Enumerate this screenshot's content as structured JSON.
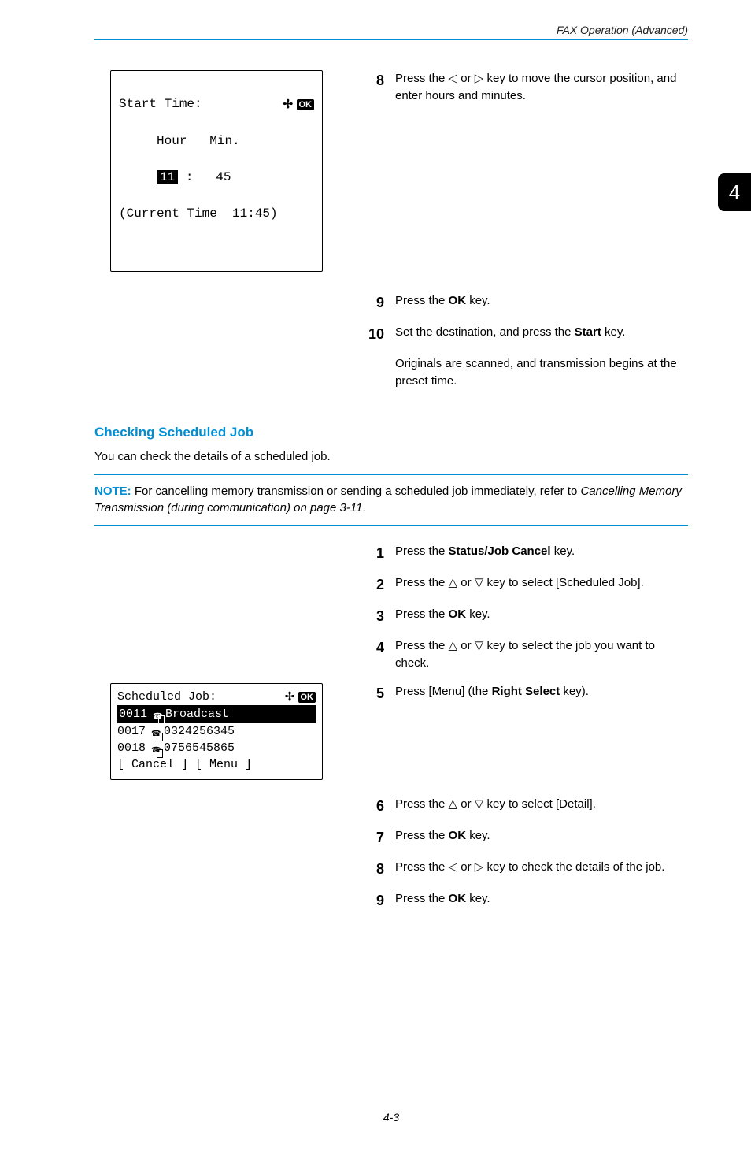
{
  "header": {
    "title": "FAX Operation (Advanced)"
  },
  "right_tab": "4",
  "lcd1": {
    "title": "Start Time:",
    "hour_label": "Hour",
    "min_label": "Min.",
    "hour_value": "11",
    "min_value": "45",
    "separator": ":",
    "current_line": "(Current Time  11:45)",
    "ok": "OK"
  },
  "step8": {
    "num": "8",
    "text_a": "Press the ",
    "text_b": " or ",
    "text_c": " key to move the cursor position, and enter hours and minutes."
  },
  "step9": {
    "num": "9",
    "text_a": "Press the ",
    "bold": "OK",
    "text_b": " key."
  },
  "step10": {
    "num": "10",
    "text_a": "Set the destination, and press the ",
    "bold": "Start",
    "text_b": " key.",
    "note": "Originals are scanned, and transmission begins at the preset time."
  },
  "section": {
    "heading": "Checking Scheduled Job",
    "para": "You can check the details of a scheduled job."
  },
  "note": {
    "label": "NOTE:",
    "text_a": " For cancelling memory transmission or sending a scheduled job immediately, refer to ",
    "italic": "Cancelling Memory Transmission (during communication) on page 3-11",
    "text_b": "."
  },
  "list2": {
    "s1": {
      "num": "1",
      "a": "Press the ",
      "bold": "Status/Job Cancel",
      "b": " key."
    },
    "s2": {
      "num": "2",
      "a": "Press the ",
      "b": " or ",
      "c": " key to select [Scheduled Job]."
    },
    "s3": {
      "num": "3",
      "a": "Press the ",
      "bold": "OK",
      "b": " key."
    },
    "s4": {
      "num": "4",
      "a": "Press the ",
      "b": " or ",
      "c": " key to select the job you want to check."
    },
    "s5": {
      "num": "5",
      "a": "Press [Menu] (the ",
      "bold": "Right Select",
      "b": " key)."
    },
    "s6": {
      "num": "6",
      "a": "Press the ",
      "b": " or ",
      "c": " key to select [Detail]."
    },
    "s7": {
      "num": "7",
      "a": "Press the ",
      "bold": "OK",
      "b": " key."
    },
    "s8": {
      "num": "8",
      "a": "Press the ",
      "b": " or ",
      "c": " key to check the details of the job."
    },
    "s9": {
      "num": "9",
      "a": "Press the ",
      "bold": "OK",
      "b": " key."
    }
  },
  "lcd2": {
    "title": "Scheduled Job:",
    "ok": "OK",
    "row1_id": "0011",
    "row1_text": "Broadcast",
    "row2_id": "0017",
    "row2_text": "0324256345",
    "row3_id": "0018",
    "row3_text": "0756545865",
    "footer": "[ Cancel ]  [  Menu  ]"
  },
  "footer": {
    "pagenum": "4-3"
  }
}
